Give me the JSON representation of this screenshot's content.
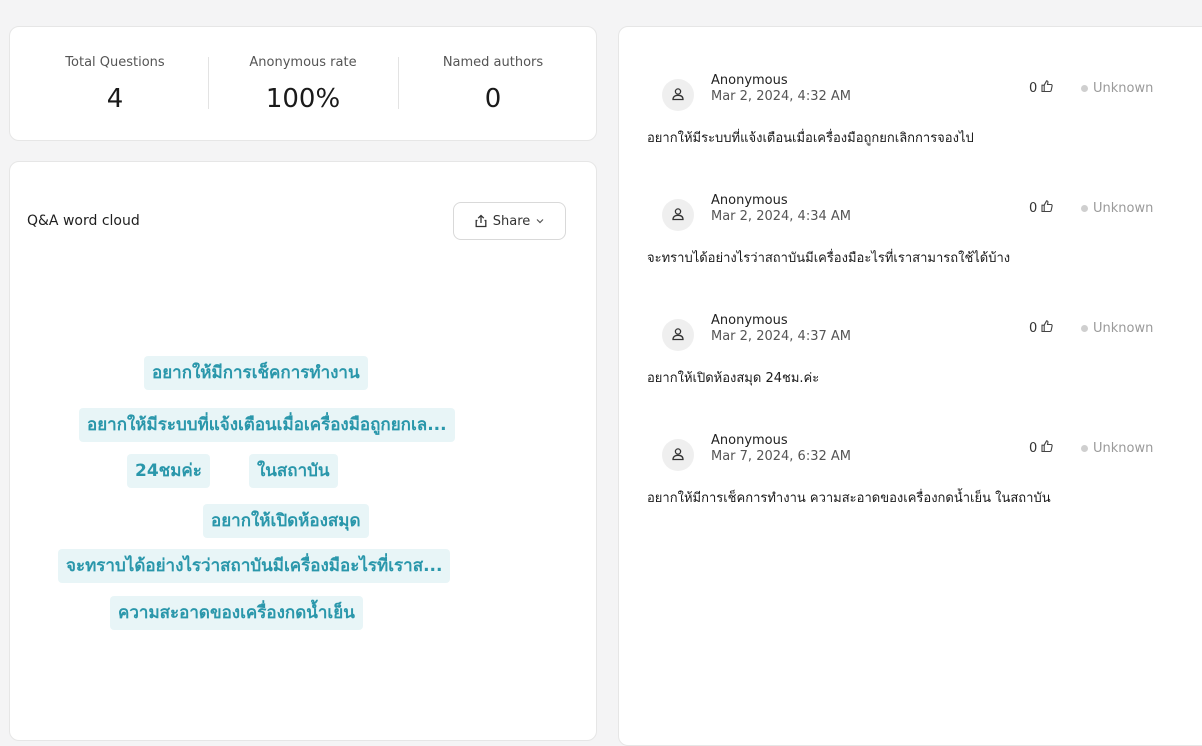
{
  "stats": {
    "items": [
      {
        "label": "Total Questions",
        "value": "4"
      },
      {
        "label": "Anonymous rate",
        "value": "100%"
      },
      {
        "label": "Named authors",
        "value": "0"
      }
    ]
  },
  "word_cloud": {
    "title": "Q&A word cloud",
    "share_label": "Share",
    "colors": {
      "word_bg": "#e8f5f7",
      "word_text": "#2a97ab"
    },
    "words": [
      "อยากให้มีการเช็คการทำงาน",
      "อยากให้มีระบบที่แจ้งเตือนเมื่อเครื่องมือถูกยกเล...",
      "24ชมค่ะ",
      "ในสถาบัน",
      "อยากให้เปิดห้องสมุด",
      "จะทราบได้อย่างไรว่าสถาบันมีเครื่องมือะไรที่เราส...",
      "ความสะอาดของเครื่องกดน้ำเย็น"
    ]
  },
  "questions": [
    {
      "author": "Anonymous",
      "date": "Mar 2, 2024, 4:32 AM",
      "likes": "0",
      "status": "Unknown",
      "text": "อยากให้มีระบบที่แจ้งเตือนเมื่อเครื่องมือถูกยกเลิกการจองไป"
    },
    {
      "author": "Anonymous",
      "date": "Mar 2, 2024, 4:34 AM",
      "likes": "0",
      "status": "Unknown",
      "text": "จะทราบได้อย่างไรว่าสถาบันมีเครื่องมือะไรที่เราสามารถใช้ได้บ้าง"
    },
    {
      "author": "Anonymous",
      "date": "Mar 2, 2024, 4:37 AM",
      "likes": "0",
      "status": "Unknown",
      "text": "อยากให้เปิดห้องสมุด 24ชม.ค่ะ"
    },
    {
      "author": "Anonymous",
      "date": "Mar 7, 2024, 6:32 AM",
      "likes": "0",
      "status": "Unknown",
      "text": "อยากให้มีการเช็คการทำงาน ความสะอาดของเครื่องกดน้ำเย็น ในสถาบัน"
    }
  ]
}
